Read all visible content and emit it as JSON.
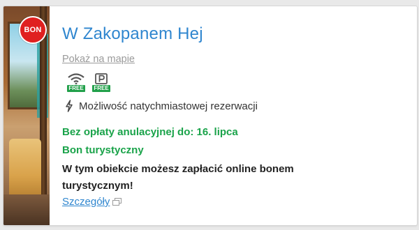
{
  "listing": {
    "badge": "BON",
    "title": "W Zakopanem Hej",
    "map_link": "Pokaż na mapie",
    "amenities": [
      {
        "icon": "wifi-icon",
        "free_label": "FREE"
      },
      {
        "icon": "parking-icon",
        "free_label": "FREE"
      }
    ],
    "instant_booking": "Możliwość natychmiastowej rezerwacji",
    "free_cancellation": "Bez opłaty anulacyjnej do: 16. lipca",
    "voucher_label": "Bon turystyczny",
    "voucher_text": "W tym obiekcie możesz zapłacić online bonem turystycznym!",
    "details_link": "Szczegóły"
  },
  "colors": {
    "title_blue": "#2f86cf",
    "green": "#1aa34a",
    "badge_red": "#e02020"
  }
}
